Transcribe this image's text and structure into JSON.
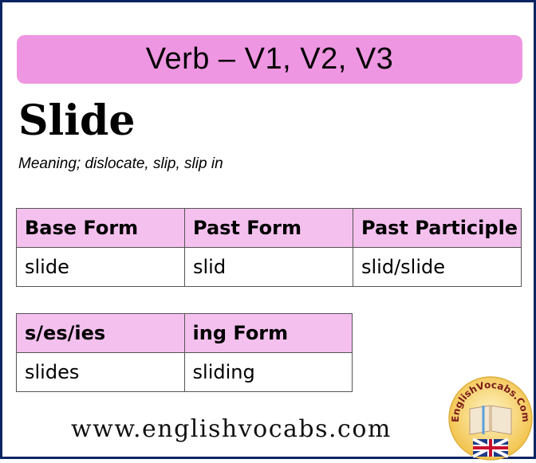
{
  "banner": {
    "title": "Verb – V1, V2, V3"
  },
  "word": "Slide",
  "meaning": "Meaning; dislocate, slip, slip in",
  "table_main": {
    "headers": [
      "Base Form",
      "Past Form",
      "Past Participle"
    ],
    "values": [
      "slide",
      "slid",
      "slid/slide"
    ]
  },
  "table_extra": {
    "headers": [
      "s/es/ies",
      "ing Form"
    ],
    "values": [
      "slides",
      "sliding"
    ]
  },
  "footer": {
    "url": "www.englishvocabs.com"
  },
  "logo": {
    "text": "EnglishVocabs.Com"
  },
  "colors": {
    "banner": "#ee96e2",
    "header_row": "#f4c0ee",
    "frame": "#0b2563"
  }
}
